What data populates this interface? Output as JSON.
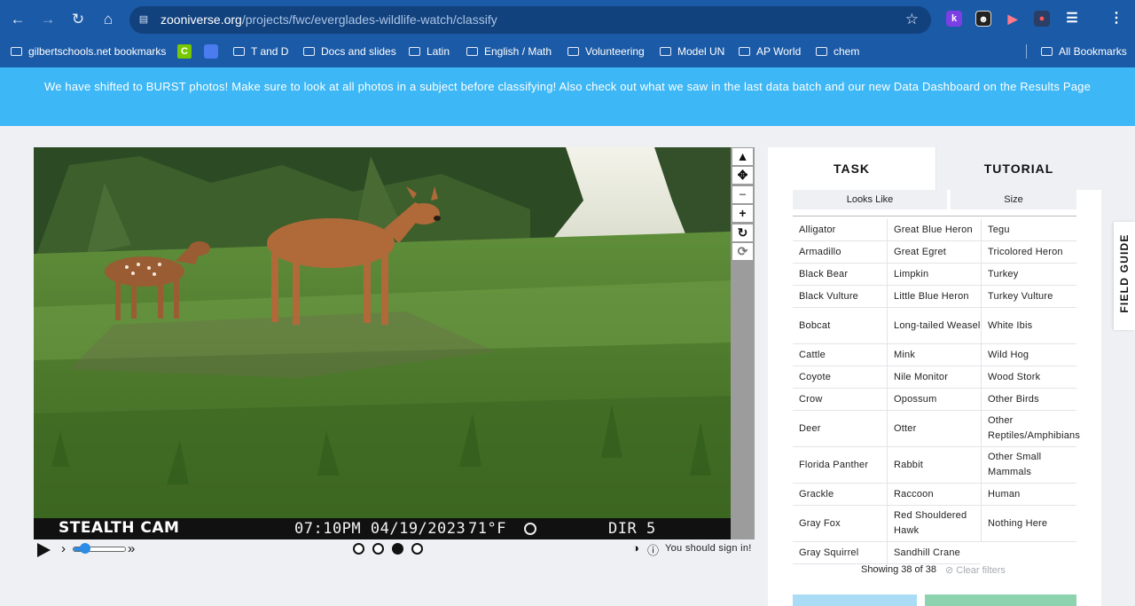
{
  "browser": {
    "url_host": "zooniverse.org",
    "url_path": "/projects/fwc/everglades-wildlife-watch/classify",
    "extensions": [
      "k",
      "",
      "",
      "",
      ""
    ],
    "bookmarks": [
      {
        "label": "gilbertschools.net bookmarks",
        "type": "folder-managed"
      },
      {
        "label": "C",
        "type": "app"
      },
      {
        "label": "",
        "type": "app"
      },
      {
        "label": "T and D",
        "type": "folder"
      },
      {
        "label": "Docs and slides",
        "type": "folder"
      },
      {
        "label": "Latin",
        "type": "folder"
      },
      {
        "label": "English / Math",
        "type": "folder"
      },
      {
        "label": "Volunteering",
        "type": "folder"
      },
      {
        "label": "Model UN",
        "type": "folder"
      },
      {
        "label": "AP World",
        "type": "folder"
      },
      {
        "label": "chem",
        "type": "folder"
      }
    ],
    "all_bookmarks": "All Bookmarks"
  },
  "banner": {
    "text": "We have shifted to BURST photos! Make sure to look at all photos in a subject before classifying! Also check out what we saw in the last data batch and our new Data Dashboard on the Results Page"
  },
  "subject": {
    "camera_brand": "STEALTH CAM",
    "stamp_time": "07:10PM 04/19/2023",
    "stamp_temp": "71°F",
    "stamp_dir": "DIR 5",
    "frames_total": 4,
    "frame_active": 3,
    "playback_speed": 0.25,
    "sign_in_text": "You should sign in!"
  },
  "panel": {
    "tabs": [
      "TASK",
      "TUTORIAL"
    ],
    "active_tab": "TASK",
    "filters": [
      "Looks Like",
      "Size"
    ],
    "choices": [
      [
        "Alligator",
        "Great Blue Heron",
        "Tegu"
      ],
      [
        "Armadillo",
        "Great Egret",
        "Tricolored Heron"
      ],
      [
        "Black Bear",
        "Limpkin",
        "Turkey"
      ],
      [
        "Black Vulture",
        "Little Blue Heron",
        "Turkey Vulture"
      ],
      [
        "Bobcat",
        "Long-tailed Weasel",
        "White Ibis"
      ],
      [
        "Cattle",
        "Mink",
        "Wild Hog"
      ],
      [
        "Coyote",
        "Nile Monitor",
        "Wood Stork"
      ],
      [
        "Crow",
        "Opossum",
        "Other Birds"
      ],
      [
        "Deer",
        "Otter",
        "Other Reptiles/Amphibians"
      ],
      [
        "Florida Panther",
        "Rabbit",
        "Other Small Mammals"
      ],
      [
        "Grackle",
        "Raccoon",
        "Human"
      ],
      [
        "Gray Fox",
        "Red Shouldered Hawk",
        "Nothing Here"
      ],
      [
        "Gray Squirrel",
        "Sandhill Crane",
        ""
      ]
    ],
    "showing": "Showing 38 of 38",
    "clear_filters": "Clear filters"
  },
  "field_guide": "FIELD GUIDE",
  "colors": {
    "chrome": "#1b5aa6",
    "banner": "#3db7f5",
    "accent": "#2b8be6"
  }
}
